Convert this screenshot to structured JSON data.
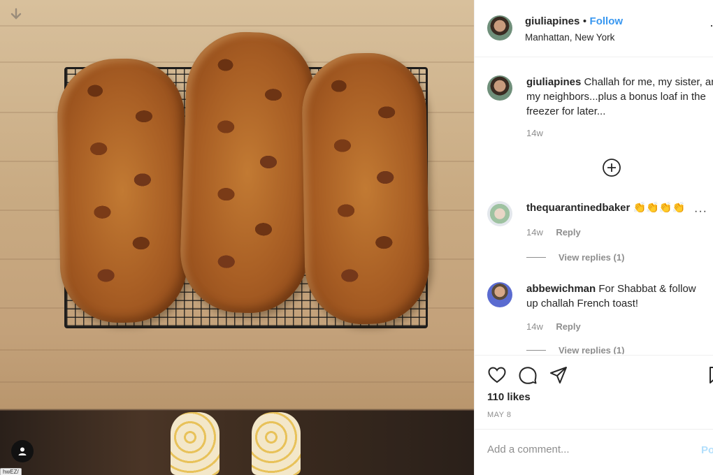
{
  "post": {
    "owner": {
      "username": "giuliapines",
      "separator": "•",
      "follow_label": "Follow",
      "location": "Manhattan, New York"
    },
    "caption": {
      "username": "giuliapines",
      "text": "Challah for me, my sister, and my neighbors...plus a bonus loaf in the freezer for later...",
      "time": "14w"
    },
    "load_more_icon": "plus-circle-icon",
    "comments": [
      {
        "username": "thequarantinedbaker",
        "text": "👏👏👏👏",
        "time": "14w",
        "reply_label": "Reply",
        "view_replies": "View replies (1)"
      },
      {
        "username": "abbewichman",
        "text": "For Shabbat & follow up challah French toast!",
        "time": "14w",
        "reply_label": "Reply",
        "view_replies": "View replies (1)"
      }
    ],
    "likes": "110 likes",
    "date": "MAY 8",
    "add_comment_placeholder": "Add a comment...",
    "post_label": "Post",
    "more_options": "···"
  },
  "colors": {
    "accent": "#3897f0",
    "muted": "#8e8e8e",
    "text": "#262626"
  }
}
